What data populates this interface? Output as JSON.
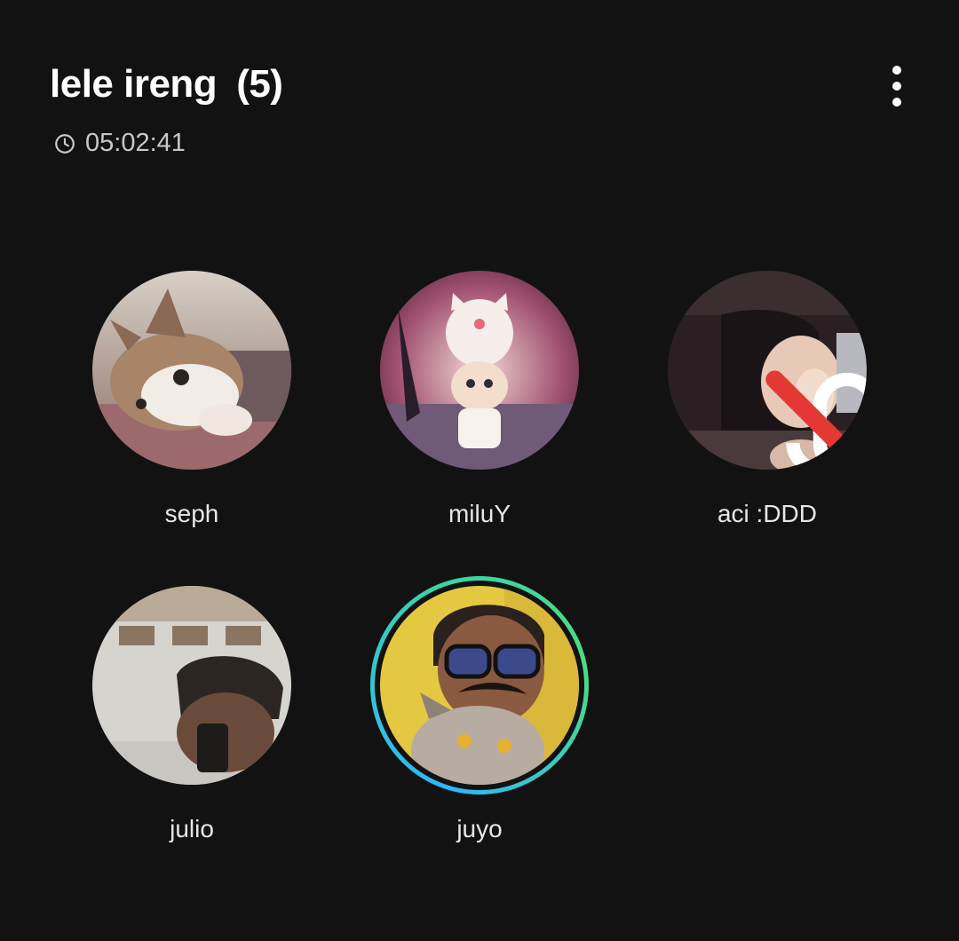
{
  "header": {
    "title": "lele ireng",
    "count": "(5)",
    "duration": "05:02:41",
    "menu_icon": "more-vertical-icon",
    "timer_icon": "clock-icon"
  },
  "participants": [
    {
      "name": "seph",
      "avatar": "kitten-photo"
    },
    {
      "name": "miluY",
      "avatar": "doll-figure-photo"
    },
    {
      "name": "aci :DDD",
      "avatar": "portrait-photo",
      "muted": true
    },
    {
      "name": "julio",
      "avatar": "selfie-photo"
    },
    {
      "name": "juyo",
      "avatar": "glasses-cat-photo",
      "speaking": true
    }
  ],
  "colors": {
    "background": "#121212",
    "speaking_ring_start": "#2bb6ff",
    "speaking_ring_end": "#4ade80",
    "mute_indicator": "#e53935"
  }
}
